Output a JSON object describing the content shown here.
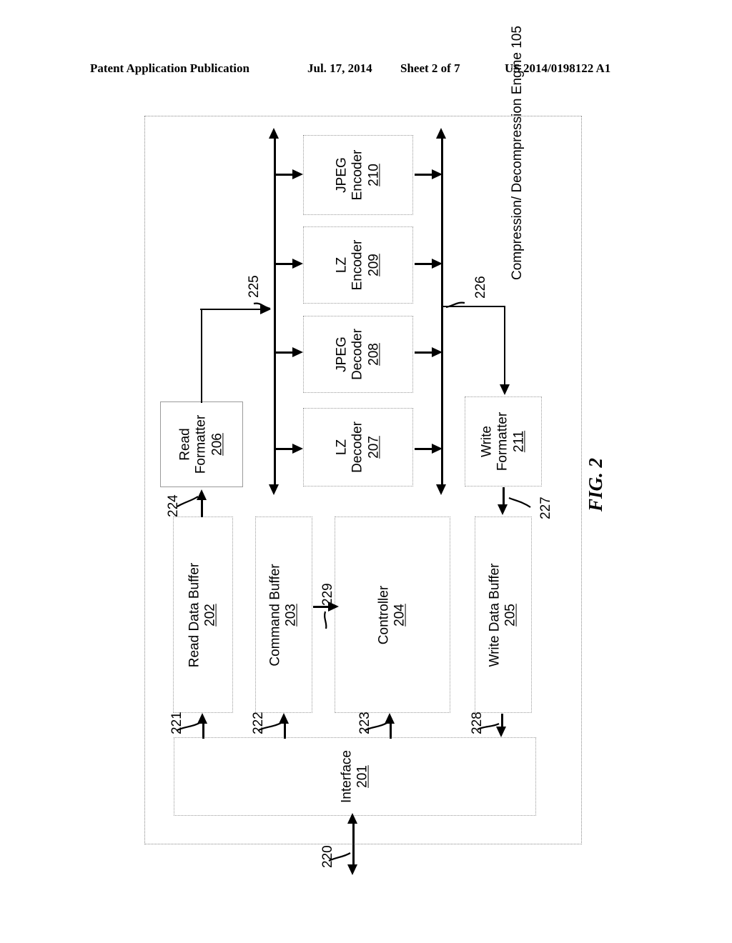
{
  "header": {
    "publication": "Patent Application Publication",
    "date": "Jul. 17, 2014",
    "sheet": "Sheet 2 of 7",
    "number": "US 2014/0198122 A1"
  },
  "figure": {
    "label": "FIG. 2",
    "engine": {
      "line1": "Compression/",
      "line2": "Decompression",
      "line3": "Engine",
      "number": "105"
    }
  },
  "blocks": {
    "interface": {
      "line1": "Interface",
      "number": "201"
    },
    "read_data_buf": {
      "line1": "Read Data Buffer",
      "number": "202"
    },
    "command_buf": {
      "line1": "Command Buffer",
      "number": "203"
    },
    "controller": {
      "line1": "Controller",
      "number": "204"
    },
    "write_data_buf": {
      "line1": "Write Data Buffer",
      "number": "205"
    },
    "read_formatter": {
      "line1": "Read",
      "line2": "Formatter",
      "number": "206"
    },
    "lz_decoder": {
      "line1": "LZ",
      "line2": "Decoder",
      "number": "207"
    },
    "jpeg_decoder": {
      "line1": "JPEG",
      "line2": "Decoder",
      "number": "208"
    },
    "lz_encoder": {
      "line1": "LZ",
      "line2": "Encoder",
      "number": "209"
    },
    "jpeg_encoder": {
      "line1": "JPEG",
      "line2": "Encoder",
      "number": "210"
    },
    "write_formatter": {
      "line1": "Write",
      "line2": "Formatter",
      "number": "211"
    }
  },
  "refs": {
    "r220": "220",
    "r221": "221",
    "r222": "222",
    "r223": "223",
    "r224": "224",
    "r225": "225",
    "r226": "226",
    "r227": "227",
    "r228": "228",
    "r229": "229"
  },
  "colors": {
    "ink": "#000000",
    "box_border": "#9a9a9a",
    "frame_border": "#888888",
    "paper": "#ffffff"
  }
}
